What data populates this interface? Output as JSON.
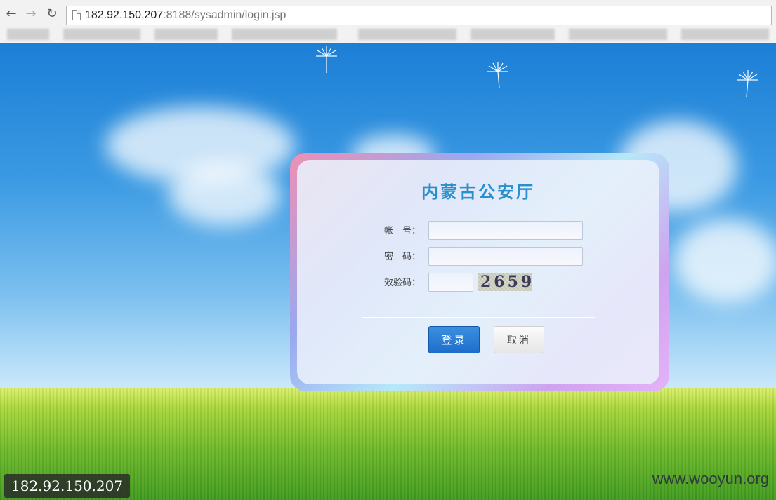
{
  "browser": {
    "url_host": "182.92.150.207",
    "url_rest": ":8188/sysadmin/login.jsp"
  },
  "login": {
    "title": "内蒙古公安厅",
    "account_label": "帐　号：",
    "password_label": "密　码：",
    "captcha_label": "效验码：",
    "captcha_code": "2659",
    "login_button": "登录",
    "cancel_button": "取消"
  },
  "overlay": {
    "ip_badge": "182.92.150.207",
    "watermark": "www.wooyun.org"
  },
  "colors": {
    "title": "#2a8fcf",
    "login_button": "#1d6ecb",
    "sky": "#2a8fdc"
  }
}
